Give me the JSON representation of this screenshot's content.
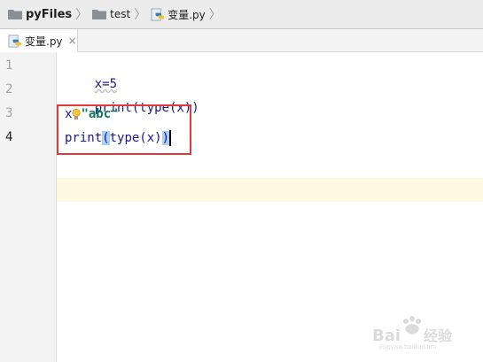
{
  "breadcrumb": {
    "items": [
      {
        "label": "pyFiles",
        "icon": "folder-icon"
      },
      {
        "label": "test",
        "icon": "folder-icon"
      },
      {
        "label": "变量.py",
        "icon": "python-file-icon"
      }
    ],
    "separator": "〉"
  },
  "tabs": [
    {
      "label": "变量.py",
      "icon": "python-file-icon",
      "close": "×"
    }
  ],
  "gutter": {
    "line_numbers": [
      "1",
      "2",
      "3",
      "4"
    ],
    "active_line": "4"
  },
  "editor": {
    "lines": [
      {
        "code": "x=5"
      },
      {
        "code": "print(type(x))"
      },
      {
        "var": "x",
        "op": "=",
        "str": "\"abc\""
      },
      {
        "p1": "print",
        "lp": "(",
        "mid": "type(x)",
        "rp": ")"
      }
    ]
  },
  "colors": {
    "highlight_box": "#e03a3a",
    "caret_line": "#fcf9e0",
    "string": "#0e7a5a",
    "keyword": "#1a1a8c"
  }
}
